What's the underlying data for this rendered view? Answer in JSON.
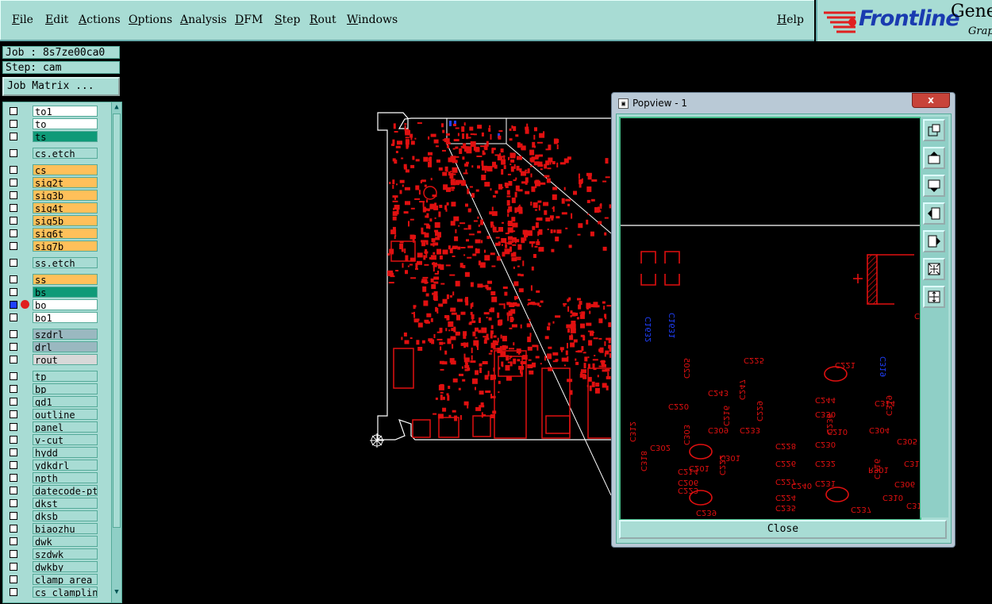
{
  "menu": {
    "items": [
      "File",
      "Edit",
      "Actions",
      "Options",
      "Analysis",
      "DFM",
      "Step",
      "Rout",
      "Windows"
    ],
    "help": "Help"
  },
  "logo": {
    "brand": "Frontline",
    "product": "Gene",
    "sub": "Grap"
  },
  "job": {
    "label": "Job : 8s7ze00ca0",
    "step": "Step: cam"
  },
  "job_matrix_button": "Job Matrix ...",
  "layers": [
    {
      "name": "to1",
      "color": "#ffffff"
    },
    {
      "name": "to",
      "color": "#ffffff"
    },
    {
      "name": "ts",
      "color": "#0f9a78"
    },
    {
      "name": "cs.etch",
      "color": "#a8dcd4"
    },
    {
      "name": "cs",
      "color": "#ffc05a"
    },
    {
      "name": "sig2t",
      "color": "#ffc05a"
    },
    {
      "name": "sig3b",
      "color": "#ffc05a"
    },
    {
      "name": "sig4t",
      "color": "#ffc05a"
    },
    {
      "name": "sig5b",
      "color": "#ffc05a"
    },
    {
      "name": "sig6t",
      "color": "#ffc05a"
    },
    {
      "name": "sig7b",
      "color": "#ffc05a"
    },
    {
      "name": "ss.etch",
      "color": "#a8dcd4"
    },
    {
      "name": "ss",
      "color": "#ffc05a"
    },
    {
      "name": "bs",
      "color": "#0f9a78"
    },
    {
      "name": "bo",
      "color": "#ffffff"
    },
    {
      "name": "bo1",
      "color": "#ffffff"
    },
    {
      "name": "szdrl",
      "color": "#9ab8c0"
    },
    {
      "name": "drl",
      "color": "#9ab8c0"
    },
    {
      "name": "rout",
      "color": "#d8d8d8"
    },
    {
      "name": "tp",
      "color": "#a8dcd4"
    },
    {
      "name": "bp",
      "color": "#a8dcd4"
    },
    {
      "name": "gd1",
      "color": "#a8dcd4"
    },
    {
      "name": "outline",
      "color": "#a8dcd4"
    },
    {
      "name": "panel",
      "color": "#a8dcd4"
    },
    {
      "name": "v-cut",
      "color": "#a8dcd4"
    },
    {
      "name": "hydd",
      "color": "#a8dcd4"
    },
    {
      "name": "ydkdrl",
      "color": "#a8dcd4"
    },
    {
      "name": "npth",
      "color": "#a8dcd4"
    },
    {
      "name": "datecode-ptc",
      "color": "#a8dcd4"
    },
    {
      "name": "dkst",
      "color": "#a8dcd4"
    },
    {
      "name": "dksb",
      "color": "#a8dcd4"
    },
    {
      "name": "biaozhu",
      "color": "#a8dcd4"
    },
    {
      "name": "dwk",
      "color": "#a8dcd4"
    },
    {
      "name": "szdwk",
      "color": "#a8dcd4"
    },
    {
      "name": "dwkby",
      "color": "#a8dcd4"
    },
    {
      "name": "clamp_area",
      "color": "#a8dcd4"
    },
    {
      "name": "cs_clampline",
      "color": "#a8dcd4"
    }
  ],
  "popview": {
    "title": "Popview - 1",
    "close_x": "x",
    "close_button": "Close",
    "labels_blue": [
      "C1632",
      "C1631",
      "C319"
    ],
    "labels_red": [
      "C225",
      "C221",
      "C205",
      "C243",
      "C247",
      "C220",
      "C229",
      "C244",
      "C314",
      "C330",
      "C312",
      "C233",
      "C210",
      "C319",
      "C309",
      "C236",
      "C230",
      "C304",
      "C305",
      "C228",
      "C216",
      "C302",
      "C303",
      "C318",
      "C201",
      "C214",
      "C206",
      "C223",
      "C227",
      "C226",
      "C232",
      "C231",
      "C315",
      "C306",
      "C310",
      "C316",
      "C311",
      "C240",
      "C224",
      "C237",
      "C235",
      "C301",
      "C222",
      "C239",
      "R301",
      "C1680"
    ]
  },
  "colors": {
    "copper": "#e01010",
    "outline": "#ffffff",
    "accent": "#a8dcd4",
    "blue": "#2040ff"
  },
  "icons": [
    "window-icon",
    "zoom-fit-icon",
    "pan-up-icon",
    "pan-down-icon",
    "pan-left-icon",
    "pan-right-icon",
    "zoom-out-icon",
    "zoom-in-icon"
  ]
}
